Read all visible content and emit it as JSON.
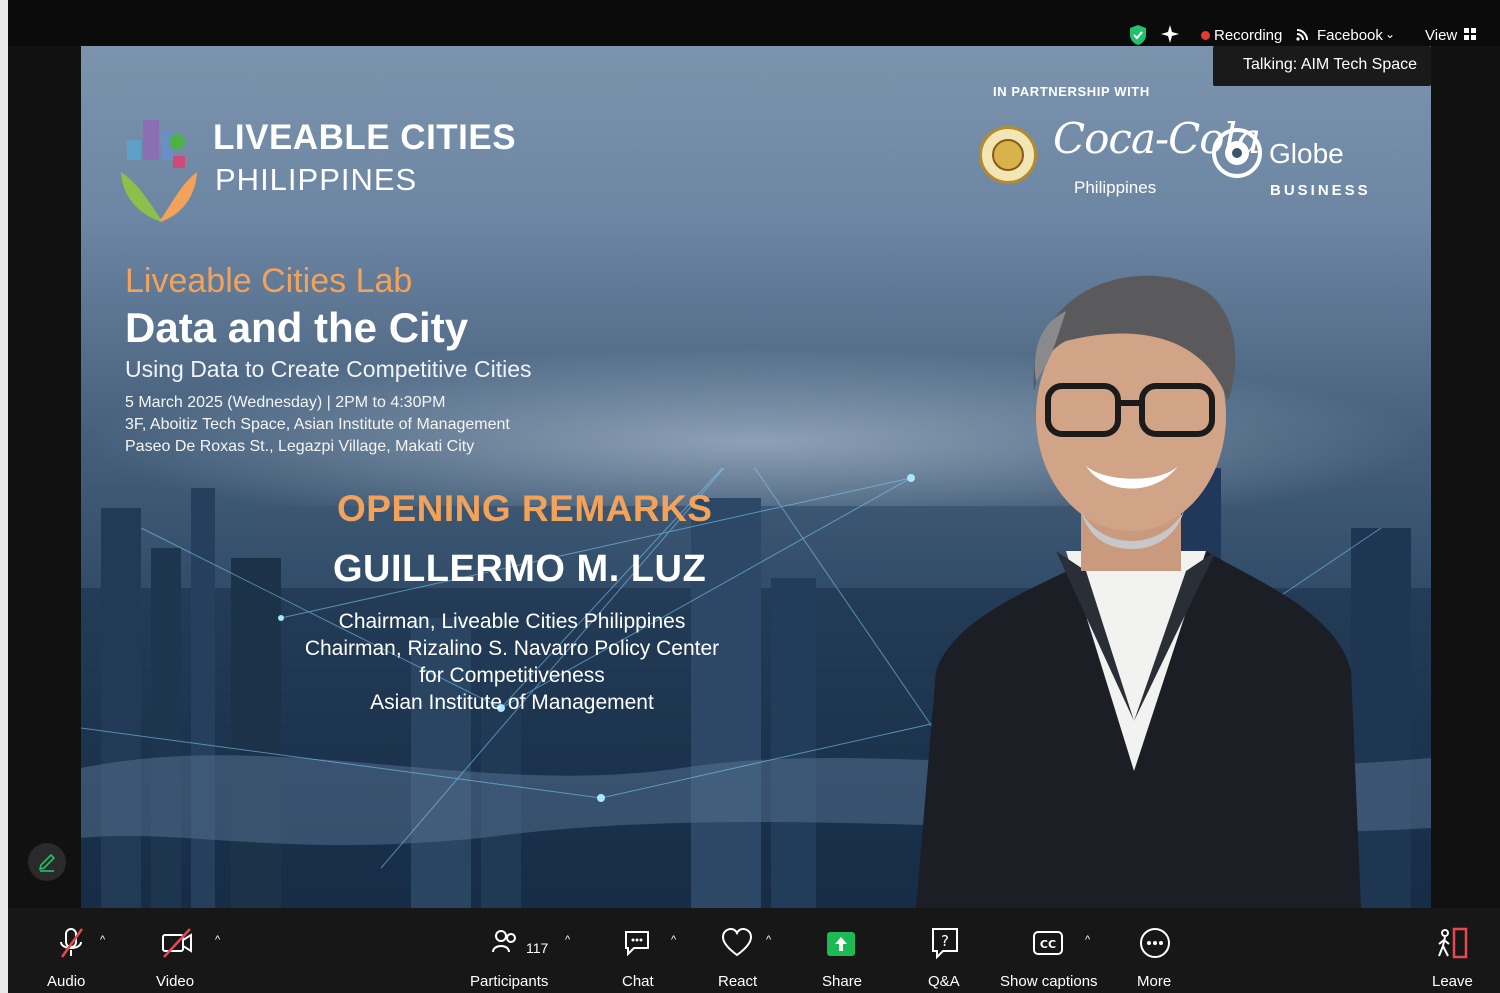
{
  "window": {
    "talking_label": "Talking: AIM Tech Space"
  },
  "status_bar": {
    "recording_label": "Recording",
    "stream_label": "Facebook",
    "view_label": "View"
  },
  "slide": {
    "org_name_line1": "LIVEABLE CITIES",
    "org_name_line2": "PHILIPPINES",
    "partnership_label": "IN PARTNERSHIP WITH",
    "partner_coke": "Coca-Cola",
    "partner_coke_sub": "Philippines",
    "partner_globe": "Globe",
    "partner_globe_sub": "BUSINESS",
    "lab_title": "Liveable Cities Lab",
    "main_title": "Data and the City",
    "sub_title": "Using Data to Create Competitive Cities",
    "event_date": "5 March 2025 (Wednesday) | 2PM to 4:30PM",
    "event_venue": "3F, Aboitiz Tech Space, Asian Institute of Management",
    "event_address": "Paseo De Roxas St., Legazpi Village, Makati City",
    "section_label": "OPENING REMARKS",
    "speaker_name": "GUILLERMO M. LUZ",
    "speaker_roles": [
      "Chairman, Liveable Cities Philippines",
      "Chairman, Rizalino S. Navarro Policy Center",
      "for Competitiveness",
      "Asian Institute of Management"
    ]
  },
  "toolbar": {
    "audio_label": "Audio",
    "video_label": "Video",
    "participants_label": "Participants",
    "participants_count": "117",
    "chat_label": "Chat",
    "react_label": "React",
    "share_label": "Share",
    "qa_label": "Q&A",
    "captions_label": "Show captions",
    "more_label": "More",
    "leave_label": "Leave"
  },
  "colors": {
    "accent_orange": "#f3a25a",
    "share_green": "#1db954",
    "recording_red": "#e53935",
    "toolbar_bg": "#171717"
  }
}
